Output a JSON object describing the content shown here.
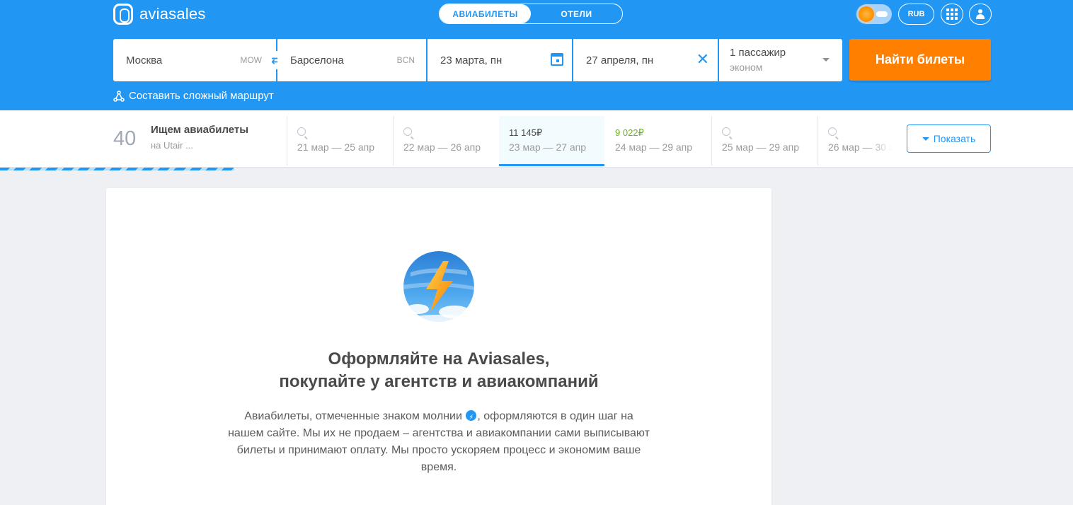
{
  "header": {
    "logo_text": "aviasales",
    "tabs": [
      {
        "label": "АВИАБИЛЕТЫ",
        "active": true
      },
      {
        "label": "ОТЕЛИ",
        "active": false
      }
    ],
    "currency": "RUB",
    "icons": [
      "theme-toggle",
      "apps-grid-icon",
      "user-icon"
    ]
  },
  "search": {
    "origin": {
      "city": "Москва",
      "iata": "MOW"
    },
    "destination": {
      "city": "Барселона",
      "iata": "BCN"
    },
    "depart_date": "23 марта, пн",
    "return_date": "27 апреля, пн",
    "passengers": "1 пассажир",
    "cabin_class": "эконом",
    "submit_label": "Найти билеты",
    "complex_route_label": "Составить сложный маршрут"
  },
  "results_bar": {
    "count": "40",
    "searching_title": "Ищем авиабилеты",
    "searching_subtitle": "на Utair ...",
    "dates": [
      {
        "price": "",
        "dates": "21 мар — 25 апр",
        "state": "loading"
      },
      {
        "price": "",
        "dates": "22 мар — 26 апр",
        "state": "loading"
      },
      {
        "price": "11 145₽",
        "dates": "23 мар — 27 апр",
        "state": "current"
      },
      {
        "price": "9 022₽",
        "dates": "24 мар — 29 апр",
        "state": "cheap"
      },
      {
        "price": "",
        "dates": "25 мар — 29 апр",
        "state": "loading"
      },
      {
        "price": "",
        "dates": "26 мар — 30 а",
        "state": "loading"
      }
    ],
    "show_button_label": "Показать"
  },
  "promo": {
    "title_line1": "Оформляйте на Aviasales,",
    "title_line2": "покупайте у агентств и авиакомпаний",
    "text_before_icon": "Авиабилеты, отмеченные знаком молнии",
    "text_after_icon": ", оформляются в один шаг на нашем сайте. Мы их не продаем – агентства и авиакомпании сами выписывают билеты и принимают оплату. Мы просто ускоряем процесс и экономим ваше время."
  },
  "colors": {
    "brand_blue": "#2196f3",
    "search_orange": "#ff8000",
    "cheap_green": "#6ab021"
  }
}
